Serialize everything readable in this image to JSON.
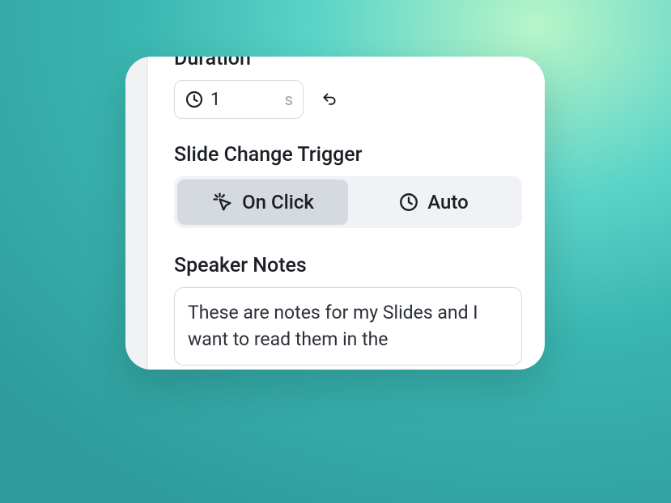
{
  "duration": {
    "label": "Duration",
    "value": "1",
    "unit": "s"
  },
  "trigger": {
    "label": "Slide Change Trigger",
    "on_click": "On Click",
    "auto": "Auto"
  },
  "notes": {
    "label": "Speaker Notes",
    "content": "These are notes for my Slides and I want to read them in the"
  }
}
